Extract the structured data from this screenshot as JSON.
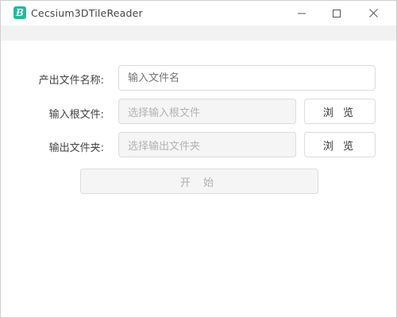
{
  "window": {
    "title": "Cecsium3DTileReader",
    "icon_glyph": "B",
    "icon_name": "app-icon",
    "accent_color": "#21b99a",
    "controls": [
      "minimize-icon",
      "maximize-icon",
      "close-icon"
    ]
  },
  "form": {
    "output_name": {
      "label": "产出文件名称:",
      "placeholder": "输入文件名",
      "value": ""
    },
    "input_root": {
      "label": "输入根文件:",
      "placeholder": "选择输入根文件",
      "browse_label": "浏 览"
    },
    "output_folder": {
      "label": "输出文件夹:",
      "placeholder": "选择输出文件夹",
      "browse_label": "浏 览"
    },
    "start_label": "开 始"
  }
}
